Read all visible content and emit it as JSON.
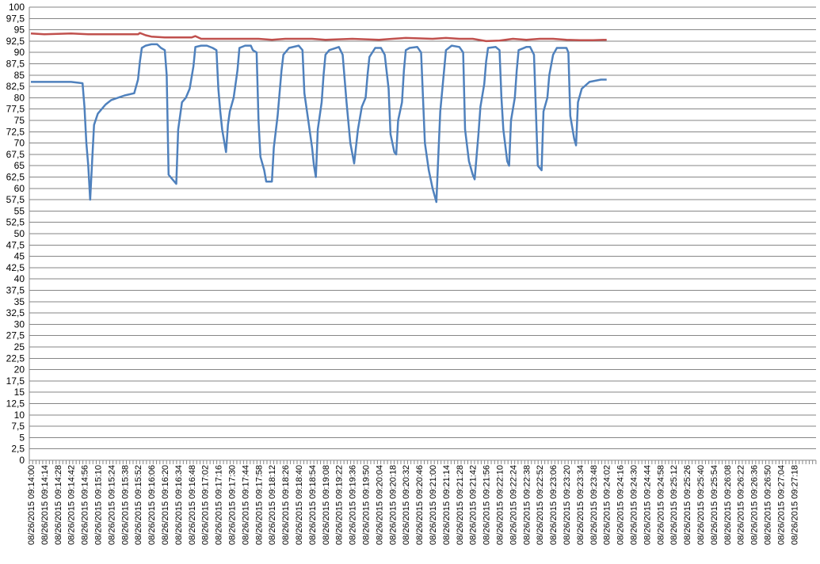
{
  "chart_data": {
    "type": "line",
    "title": "",
    "xlabel": "",
    "ylabel": "",
    "ylim": [
      0,
      100
    ],
    "y_tick_step": 2.5,
    "y_tick_labels": [
      "0",
      "2,5",
      "5",
      "7,5",
      "10",
      "12,5",
      "15",
      "17,5",
      "20",
      "22,5",
      "25",
      "27,5",
      "30",
      "32,5",
      "35",
      "37,5",
      "40",
      "42,5",
      "45",
      "47,5",
      "50",
      "52,5",
      "55",
      "57,5",
      "60",
      "62,5",
      "65",
      "67,5",
      "70",
      "72,5",
      "75",
      "77,5",
      "80",
      "82,5",
      "85",
      "87,5",
      "90",
      "92,5",
      "95",
      "97,5",
      "100"
    ],
    "grid": true,
    "legend": "none",
    "x_tick_labels": [
      "08/26/2015 09:14:00",
      "08/26/2015 09:14:14",
      "08/26/2015 09:14:28",
      "08/26/2015 09:14:42",
      "08/26/2015 09:14:56",
      "08/26/2015 09:15:10",
      "08/26/2015 09:15:24",
      "08/26/2015 09:15:38",
      "08/26/2015 09:15:52",
      "08/26/2015 09:16:06",
      "08/26/2015 09:16:20",
      "08/26/2015 09:16:34",
      "08/26/2015 09:16:48",
      "08/26/2015 09:17:02",
      "08/26/2015 09:17:16",
      "08/26/2015 09:17:30",
      "08/26/2015 09:17:44",
      "08/26/2015 09:17:58",
      "08/26/2015 09:18:12",
      "08/26/2015 09:18:26",
      "08/26/2015 09:18:40",
      "08/26/2015 09:18:54",
      "08/26/2015 09:19:08",
      "08/26/2015 09:19:22",
      "08/26/2015 09:19:36",
      "08/26/2015 09:19:50",
      "08/26/2015 09:20:04",
      "08/26/2015 09:20:18",
      "08/26/2015 09:20:32",
      "08/26/2015 09:20:46",
      "08/26/2015 09:21:00",
      "08/26/2015 09:21:14",
      "08/26/2015 09:21:28",
      "08/26/2015 09:21:42",
      "08/26/2015 09:21:56",
      "08/26/2015 09:22:10",
      "08/26/2015 09:22:24",
      "08/26/2015 09:22:38",
      "08/26/2015 09:22:52",
      "08/26/2015 09:23:06",
      "08/26/2015 09:23:20",
      "08/26/2015 09:23:34",
      "08/26/2015 09:23:48",
      "08/26/2015 09:24:02",
      "08/26/2015 09:24:16",
      "08/26/2015 09:24:30",
      "08/26/2015 09:24:44",
      "08/26/2015 09:24:58",
      "08/26/2015 09:25:12",
      "08/26/2015 09:25:26",
      "08/26/2015 09:25:40",
      "08/26/2015 09:25:54",
      "08/26/2015 09:26:08",
      "08/26/2015 09:26:22",
      "08/26/2015 09:26:36",
      "08/26/2015 09:26:50",
      "08/26/2015 09:27:04",
      "08/26/2015 09:27:18"
    ],
    "series": [
      {
        "color": "#4f81bd",
        "points": [
          [
            "08/26/2015 09:14:00",
            83.5
          ],
          [
            "08/26/2015 09:14:14",
            83.5
          ],
          [
            "08/26/2015 09:14:28",
            83.5
          ],
          [
            "08/26/2015 09:14:42",
            83.5
          ],
          [
            "08/26/2015 09:14:50",
            83.3
          ],
          [
            "08/26/2015 09:14:54",
            83.2
          ],
          [
            "08/26/2015 09:14:56",
            78
          ],
          [
            "08/26/2015 09:14:58",
            70
          ],
          [
            "08/26/2015 09:15:00",
            65
          ],
          [
            "08/26/2015 09:15:02",
            57.5
          ],
          [
            "08/26/2015 09:15:04",
            66
          ],
          [
            "08/26/2015 09:15:06",
            74
          ],
          [
            "08/26/2015 09:15:10",
            76.5
          ],
          [
            "08/26/2015 09:15:18",
            78.5
          ],
          [
            "08/26/2015 09:15:24",
            79.5
          ],
          [
            "08/26/2015 09:15:38",
            80.5
          ],
          [
            "08/26/2015 09:15:48",
            81
          ],
          [
            "08/26/2015 09:15:52",
            84
          ],
          [
            "08/26/2015 09:15:54",
            88
          ],
          [
            "08/26/2015 09:15:56",
            91
          ],
          [
            "08/26/2015 09:16:00",
            91.5
          ],
          [
            "08/26/2015 09:16:06",
            91.8
          ],
          [
            "08/26/2015 09:16:12",
            91.8
          ],
          [
            "08/26/2015 09:16:16",
            91
          ],
          [
            "08/26/2015 09:16:20",
            90.5
          ],
          [
            "08/26/2015 09:16:22",
            85
          ],
          [
            "08/26/2015 09:16:24",
            63
          ],
          [
            "08/26/2015 09:16:28",
            62
          ],
          [
            "08/26/2015 09:16:32",
            61
          ],
          [
            "08/26/2015 09:16:34",
            73
          ],
          [
            "08/26/2015 09:16:38",
            79
          ],
          [
            "08/26/2015 09:16:42",
            80
          ],
          [
            "08/26/2015 09:16:46",
            82
          ],
          [
            "08/26/2015 09:16:50",
            87
          ],
          [
            "08/26/2015 09:16:52",
            91.2
          ],
          [
            "08/26/2015 09:16:58",
            91.5
          ],
          [
            "08/26/2015 09:17:04",
            91.5
          ],
          [
            "08/26/2015 09:17:10",
            91
          ],
          [
            "08/26/2015 09:17:14",
            90.5
          ],
          [
            "08/26/2015 09:17:16",
            82
          ],
          [
            "08/26/2015 09:17:18",
            77
          ],
          [
            "08/26/2015 09:17:20",
            73
          ],
          [
            "08/26/2015 09:17:24",
            68
          ],
          [
            "08/26/2015 09:17:26",
            74
          ],
          [
            "08/26/2015 09:17:28",
            77
          ],
          [
            "08/26/2015 09:17:32",
            80
          ],
          [
            "08/26/2015 09:17:36",
            86
          ],
          [
            "08/26/2015 09:17:38",
            91
          ],
          [
            "08/26/2015 09:17:44",
            91.5
          ],
          [
            "08/26/2015 09:17:50",
            91.5
          ],
          [
            "08/26/2015 09:17:52",
            90.5
          ],
          [
            "08/26/2015 09:17:56",
            90
          ],
          [
            "08/26/2015 09:17:58",
            75
          ],
          [
            "08/26/2015 09:18:00",
            67
          ],
          [
            "08/26/2015 09:18:04",
            64
          ],
          [
            "08/26/2015 09:18:06",
            61.5
          ],
          [
            "08/26/2015 09:18:12",
            61.5
          ],
          [
            "08/26/2015 09:18:14",
            69
          ],
          [
            "08/26/2015 09:18:18",
            76
          ],
          [
            "08/26/2015 09:18:22",
            86
          ],
          [
            "08/26/2015 09:18:24",
            89.5
          ],
          [
            "08/26/2015 09:18:30",
            91
          ],
          [
            "08/26/2015 09:18:40",
            91.5
          ],
          [
            "08/26/2015 09:18:44",
            90.5
          ],
          [
            "08/26/2015 09:18:46",
            81
          ],
          [
            "08/26/2015 09:18:50",
            75
          ],
          [
            "08/26/2015 09:18:54",
            69
          ],
          [
            "08/26/2015 09:18:56",
            65
          ],
          [
            "08/26/2015 09:18:58",
            62.5
          ],
          [
            "08/26/2015 09:19:00",
            73
          ],
          [
            "08/26/2015 09:19:04",
            79
          ],
          [
            "08/26/2015 09:19:06",
            85
          ],
          [
            "08/26/2015 09:19:08",
            89.5
          ],
          [
            "08/26/2015 09:19:12",
            90.5
          ],
          [
            "08/26/2015 09:19:22",
            91.2
          ],
          [
            "08/26/2015 09:19:26",
            89.5
          ],
          [
            "08/26/2015 09:19:30",
            79
          ],
          [
            "08/26/2015 09:19:34",
            70
          ],
          [
            "08/26/2015 09:19:38",
            65.5
          ],
          [
            "08/26/2015 09:19:42",
            73
          ],
          [
            "08/26/2015 09:19:46",
            78
          ],
          [
            "08/26/2015 09:19:50",
            80
          ],
          [
            "08/26/2015 09:19:52",
            85
          ],
          [
            "08/26/2015 09:19:54",
            89
          ],
          [
            "08/26/2015 09:20:00",
            91
          ],
          [
            "08/26/2015 09:20:06",
            91
          ],
          [
            "08/26/2015 09:20:10",
            89.5
          ],
          [
            "08/26/2015 09:20:14",
            82
          ],
          [
            "08/26/2015 09:20:16",
            72
          ],
          [
            "08/26/2015 09:20:20",
            68
          ],
          [
            "08/26/2015 09:20:22",
            67.5
          ],
          [
            "08/26/2015 09:20:24",
            75
          ],
          [
            "08/26/2015 09:20:28",
            79
          ],
          [
            "08/26/2015 09:20:30",
            86
          ],
          [
            "08/26/2015 09:20:32",
            90.5
          ],
          [
            "08/26/2015 09:20:36",
            91
          ],
          [
            "08/26/2015 09:20:44",
            91.2
          ],
          [
            "08/26/2015 09:20:48",
            90
          ],
          [
            "08/26/2015 09:20:52",
            70
          ],
          [
            "08/26/2015 09:20:56",
            64
          ],
          [
            "08/26/2015 09:21:00",
            60
          ],
          [
            "08/26/2015 09:21:04",
            57
          ],
          [
            "08/26/2015 09:21:06",
            67
          ],
          [
            "08/26/2015 09:21:08",
            77
          ],
          [
            "08/26/2015 09:21:12",
            86
          ],
          [
            "08/26/2015 09:21:14",
            90.5
          ],
          [
            "08/26/2015 09:21:20",
            91.5
          ],
          [
            "08/26/2015 09:21:28",
            91.2
          ],
          [
            "08/26/2015 09:21:32",
            90
          ],
          [
            "08/26/2015 09:21:34",
            73
          ],
          [
            "08/26/2015 09:21:38",
            66
          ],
          [
            "08/26/2015 09:21:42",
            63
          ],
          [
            "08/26/2015 09:21:44",
            62
          ],
          [
            "08/26/2015 09:21:48",
            72
          ],
          [
            "08/26/2015 09:21:50",
            78
          ],
          [
            "08/26/2015 09:21:54",
            83
          ],
          [
            "08/26/2015 09:21:56",
            88
          ],
          [
            "08/26/2015 09:21:58",
            91
          ],
          [
            "08/26/2015 09:22:06",
            91.2
          ],
          [
            "08/26/2015 09:22:10",
            90.5
          ],
          [
            "08/26/2015 09:22:12",
            80
          ],
          [
            "08/26/2015 09:22:14",
            73
          ],
          [
            "08/26/2015 09:22:18",
            66
          ],
          [
            "08/26/2015 09:22:20",
            65
          ],
          [
            "08/26/2015 09:22:22",
            75
          ],
          [
            "08/26/2015 09:22:26",
            80
          ],
          [
            "08/26/2015 09:22:28",
            86
          ],
          [
            "08/26/2015 09:22:30",
            90.5
          ],
          [
            "08/26/2015 09:22:38",
            91.2
          ],
          [
            "08/26/2015 09:22:42",
            91.2
          ],
          [
            "08/26/2015 09:22:46",
            89.5
          ],
          [
            "08/26/2015 09:22:50",
            65
          ],
          [
            "08/26/2015 09:22:52",
            64.5
          ],
          [
            "08/26/2015 09:22:54",
            64
          ],
          [
            "08/26/2015 09:22:56",
            77
          ],
          [
            "08/26/2015 09:23:00",
            80
          ],
          [
            "08/26/2015 09:23:02",
            85
          ],
          [
            "08/26/2015 09:23:06",
            89.5
          ],
          [
            "08/26/2015 09:23:10",
            91
          ],
          [
            "08/26/2015 09:23:20",
            91
          ],
          [
            "08/26/2015 09:23:22",
            90
          ],
          [
            "08/26/2015 09:23:24",
            76
          ],
          [
            "08/26/2015 09:23:28",
            71
          ],
          [
            "08/26/2015 09:23:30",
            69.5
          ],
          [
            "08/26/2015 09:23:32",
            79
          ],
          [
            "08/26/2015 09:23:36",
            82
          ],
          [
            "08/26/2015 09:23:44",
            83.5
          ],
          [
            "08/26/2015 09:23:56",
            84
          ],
          [
            "08/26/2015 09:24:02",
            84
          ]
        ]
      },
      {
        "color": "#c0504d",
        "points": [
          [
            "08/26/2015 09:14:00",
            94.2
          ],
          [
            "08/26/2015 09:14:14",
            94
          ],
          [
            "08/26/2015 09:14:42",
            94.2
          ],
          [
            "08/26/2015 09:15:00",
            94
          ],
          [
            "08/26/2015 09:15:38",
            94
          ],
          [
            "08/26/2015 09:15:52",
            94
          ],
          [
            "08/26/2015 09:15:54",
            94.3
          ],
          [
            "08/26/2015 09:16:00",
            93.8
          ],
          [
            "08/26/2015 09:16:06",
            93.5
          ],
          [
            "08/26/2015 09:16:20",
            93.3
          ],
          [
            "08/26/2015 09:16:48",
            93.3
          ],
          [
            "08/26/2015 09:16:52",
            93.6
          ],
          [
            "08/26/2015 09:16:58",
            93
          ],
          [
            "08/26/2015 09:17:30",
            93
          ],
          [
            "08/26/2015 09:17:44",
            93
          ],
          [
            "08/26/2015 09:17:58",
            93
          ],
          [
            "08/26/2015 09:18:12",
            92.8
          ],
          [
            "08/26/2015 09:18:26",
            93
          ],
          [
            "08/26/2015 09:18:54",
            93
          ],
          [
            "08/26/2015 09:19:08",
            92.8
          ],
          [
            "08/26/2015 09:19:36",
            93
          ],
          [
            "08/26/2015 09:20:04",
            92.8
          ],
          [
            "08/26/2015 09:20:18",
            93
          ],
          [
            "08/26/2015 09:20:32",
            93.2
          ],
          [
            "08/26/2015 09:21:00",
            93
          ],
          [
            "08/26/2015 09:21:14",
            93.2
          ],
          [
            "08/26/2015 09:21:28",
            93
          ],
          [
            "08/26/2015 09:21:42",
            93
          ],
          [
            "08/26/2015 09:21:56",
            92.5
          ],
          [
            "08/26/2015 09:22:10",
            92.6
          ],
          [
            "08/26/2015 09:22:24",
            93
          ],
          [
            "08/26/2015 09:22:38",
            92.8
          ],
          [
            "08/26/2015 09:22:52",
            93
          ],
          [
            "08/26/2015 09:23:06",
            93
          ],
          [
            "08/26/2015 09:23:20",
            92.8
          ],
          [
            "08/26/2015 09:23:34",
            92.7
          ],
          [
            "08/26/2015 09:23:48",
            92.7
          ],
          [
            "08/26/2015 09:24:02",
            92.8
          ]
        ]
      }
    ]
  }
}
